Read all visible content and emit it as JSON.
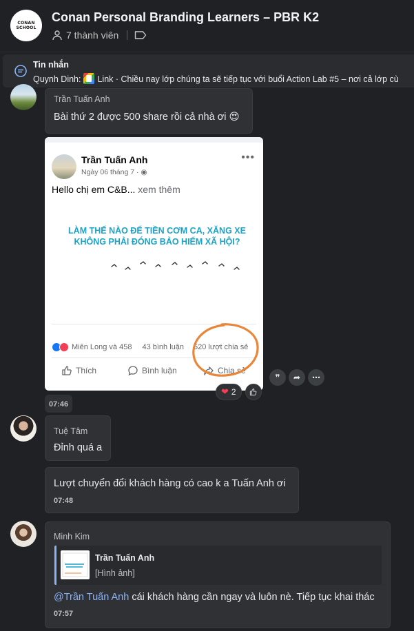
{
  "header": {
    "logo_line1": "CONAN",
    "logo_line2": "SCHOOL",
    "title": "Conan Personal Branding Learners – PBR K2",
    "members": "7 thành viên"
  },
  "banner": {
    "title": "Tin nhắn",
    "sender": "Quynh Dinh:",
    "text": "Link · Chiều nay lớp chúng ta sẽ tiếp tục với buổi Action Lab #5 – nơi cả lớp cù"
  },
  "messages": [
    {
      "sender": "Trần Tuấn Anh",
      "text": "Bài thứ 2 được 500 share rồi cả nhà ơi 😍",
      "time": "07:46"
    },
    {
      "sender": "Tuệ Tâm",
      "text": "Đỉnh quá a",
      "text2": "Lượt chuyển đổi khách hàng có cao k a Tuấn Anh ơi",
      "time": "07:48"
    },
    {
      "sender": "Minh Kim",
      "mention": "@Trần Tuấn Anh",
      "text": " cái khách hàng cần ngay và luôn nè. Tiếp tục khai thác",
      "time": "07:57",
      "quote_name": "Trần Tuấn Anh",
      "quote_type": "[Hình ảnh]"
    }
  ],
  "screenshot_post": {
    "author": "Trần Tuấn Anh",
    "date": "Ngày 06 tháng 7 · ",
    "text": "Hello chị em C&B... ",
    "see_more": "xem thêm",
    "headline": "LÀM THẾ NÀO ĐỂ TIỀN CƠM CA, XĂNG XE KHÔNG PHẢI ĐÓNG BẢO HIỂM XÃ HỘI?",
    "reactions": "Miên Long và 458",
    "comments": "43 bình luận",
    "shares": "520 lượt chia sẻ",
    "like": "Thích",
    "comment": "Bình luận",
    "share": "Chia sẻ"
  },
  "reaction": {
    "count": "2"
  },
  "colors": {
    "background": "#202124",
    "bubble": "#303134",
    "mention": "#8ab4f8",
    "headline": "#1aa3c8",
    "circle": "#e8863a"
  }
}
